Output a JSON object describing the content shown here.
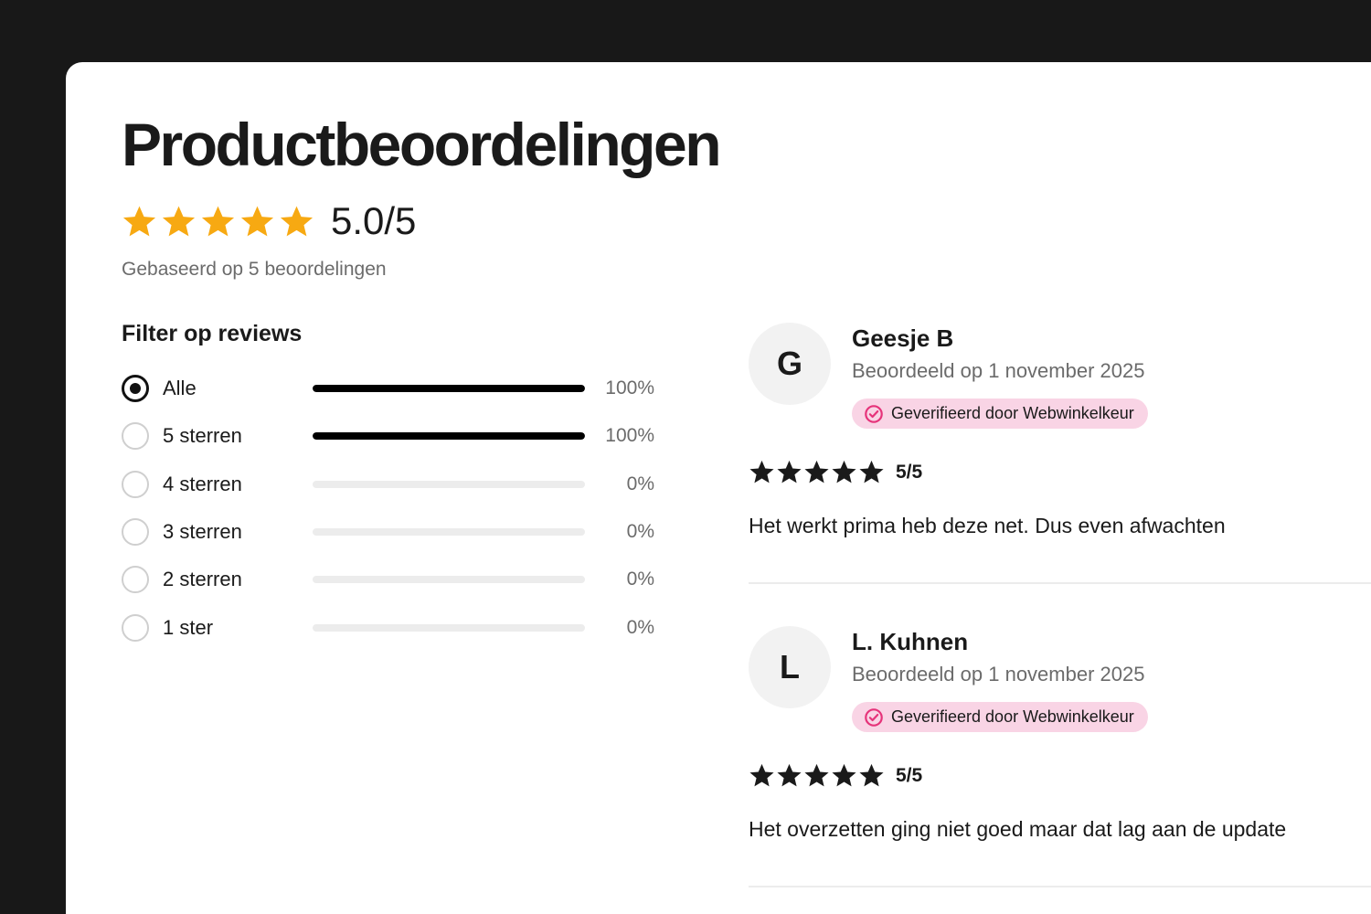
{
  "page": {
    "title": "Productbeoordelingen",
    "score": "5.0/5",
    "star_rating": 5,
    "based_on": "Gebaseerd op 5 beoordelingen"
  },
  "filter": {
    "title": "Filter op reviews",
    "options": [
      {
        "label": "Alle",
        "percent_label": "100%",
        "fill_fraction": 1.0,
        "selected": true
      },
      {
        "label": "5 sterren",
        "percent_label": "100%",
        "fill_fraction": 1.0,
        "selected": false
      },
      {
        "label": "4 sterren",
        "percent_label": "0%",
        "fill_fraction": 0,
        "selected": false
      },
      {
        "label": "3 sterren",
        "percent_label": "0%",
        "fill_fraction": 0,
        "selected": false
      },
      {
        "label": "2 sterren",
        "percent_label": "0%",
        "fill_fraction": 0,
        "selected": false
      },
      {
        "label": "1 ster",
        "percent_label": "0%",
        "fill_fraction": 0,
        "selected": false
      }
    ]
  },
  "reviews": [
    {
      "avatar_initial": "G",
      "name": "Geesje B",
      "date": "Beoordeeld op 1 november 2025",
      "verified": "Geverifieerd door Webwinkelkeur",
      "rating_label": "5/5",
      "stars": 5,
      "text": "Het werkt prima heb deze net. Dus even afwachten"
    },
    {
      "avatar_initial": "L",
      "name": "L. Kuhnen",
      "date": "Beoordeeld op 1 november 2025",
      "verified": "Geverifieerd door Webwinkelkeur",
      "rating_label": "5/5",
      "stars": 5,
      "text": "Het overzetten ging niet goed maar dat lag aan de update"
    }
  ],
  "colors": {
    "accent_star": "#f7a912",
    "dark_star": "#1a1a1a",
    "verified_bg": "#f9d4e5",
    "verified_icon": "#e6337a",
    "background": "#181818"
  },
  "icons": {
    "star": "star-icon",
    "verified": "verified-check-icon"
  }
}
